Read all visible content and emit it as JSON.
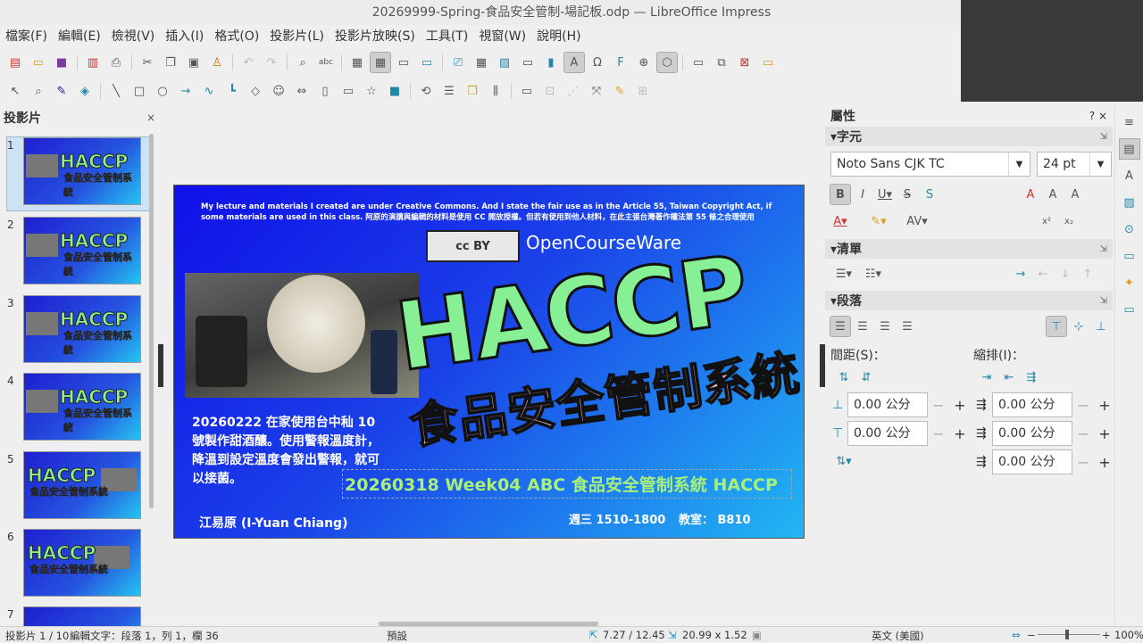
{
  "window": {
    "title": "20269999-Spring-食品安全管制-場記板.odp — LibreOffice Impress"
  },
  "menu": [
    "檔案(F)",
    "編輯(E)",
    "檢視(V)",
    "插入(I)",
    "格式(O)",
    "投影片(L)",
    "投影片放映(S)",
    "工具(T)",
    "視窗(W)",
    "說明(H)"
  ],
  "toolbar1": [
    "new-icon",
    "open-icon",
    "save-icon",
    "export-pdf-icon",
    "print-icon",
    "cut-icon",
    "copy-icon",
    "paste-icon",
    "clone-icon",
    "undo-icon",
    "redo-icon",
    "find-replace-icon",
    "spelling-icon",
    "grid-icon",
    "display-views-icon",
    "master-slide-icon",
    "slide-icon",
    "presentation-icon",
    "table-icon",
    "image-icon",
    "media-icon",
    "chart-icon",
    "textbox-icon",
    "special-char-icon",
    "fontwork-icon",
    "hyperlink-icon",
    "points-icon",
    "slide-layout-icon",
    "duplicate-slide-icon",
    "delete-slide-icon",
    "display-mode-icon"
  ],
  "toolbar2": [
    "select-icon",
    "zoom-icon",
    "line-color-icon",
    "fill-color-icon",
    "line-icon",
    "rectangle-icon",
    "ellipse-icon",
    "arrow-icon",
    "curve-icon",
    "connector-icon",
    "basic-shapes-icon",
    "symbol-shapes-icon",
    "block-arrows-icon",
    "flowchart-icon",
    "callouts-icon",
    "stars-icon",
    "3d-objects-icon",
    "rotate-icon",
    "align-icon",
    "arrange-icon",
    "distribute-icon",
    "shadow-icon",
    "crop-icon",
    "filter-icon",
    "toggle-extrusion-icon",
    "transformations-icon",
    "glue-points-icon"
  ],
  "slides_pane": {
    "title": "投影片",
    "close": "×",
    "items": [
      {
        "num": "1"
      },
      {
        "num": "2"
      },
      {
        "num": "3"
      },
      {
        "num": "4"
      },
      {
        "num": "5"
      },
      {
        "num": "6"
      },
      {
        "num": "7"
      }
    ]
  },
  "slide": {
    "license": "My lecture and materials I created are under Creative Commons. And I  state the fair use as in the Article 55, Taiwan Copyright Act, if some materials are used in this class.  阿原的演講與編輯的材料是使用 CC 開放授權。但若有使用到他人材料，在此主張台灣著作權法第  55  條之合理使用",
    "cc_badge": "cc  BY",
    "ocw": "OpenCourseWare",
    "haccp": "HACCP",
    "subtitle": "食品安全管制系統",
    "note": "20260222  在家使用台中秈 10 號製作甜酒釀。使用警報溫度計，降溫到設定溫度會發出警報，就可以接菌。",
    "week": "20260318 Week04 ABC  食品安全管制系統  HACCP",
    "author": "江易原 (I-Yuan Chiang)",
    "time": "週三  1510-1800",
    "room": "教室：  B810"
  },
  "sidebar": {
    "title": "屬性",
    "help": "?",
    "close": "×",
    "char_section": "字元",
    "font_name": "Noto Sans CJK TC",
    "font_size": "24 pt",
    "lists_section": "清單",
    "para_section": "段落",
    "spacing_label": "間距(S)：",
    "indent_label": "縮排(I)：",
    "spacing_above": "0.00 公分",
    "spacing_below": "0.00 公分",
    "indent_before": "0.00 公分",
    "indent_after": "0.00 公分",
    "indent_first": "0.00 公分"
  },
  "status": {
    "slide": "投影片 1 / 10",
    "edit": "編輯文字：段落 1，列 1，欄 36",
    "layout": "預設",
    "position": "7.27 / 12.45",
    "size": "20.99 x 1.52",
    "lang": "英文 (美國)",
    "zoom": "100%"
  }
}
